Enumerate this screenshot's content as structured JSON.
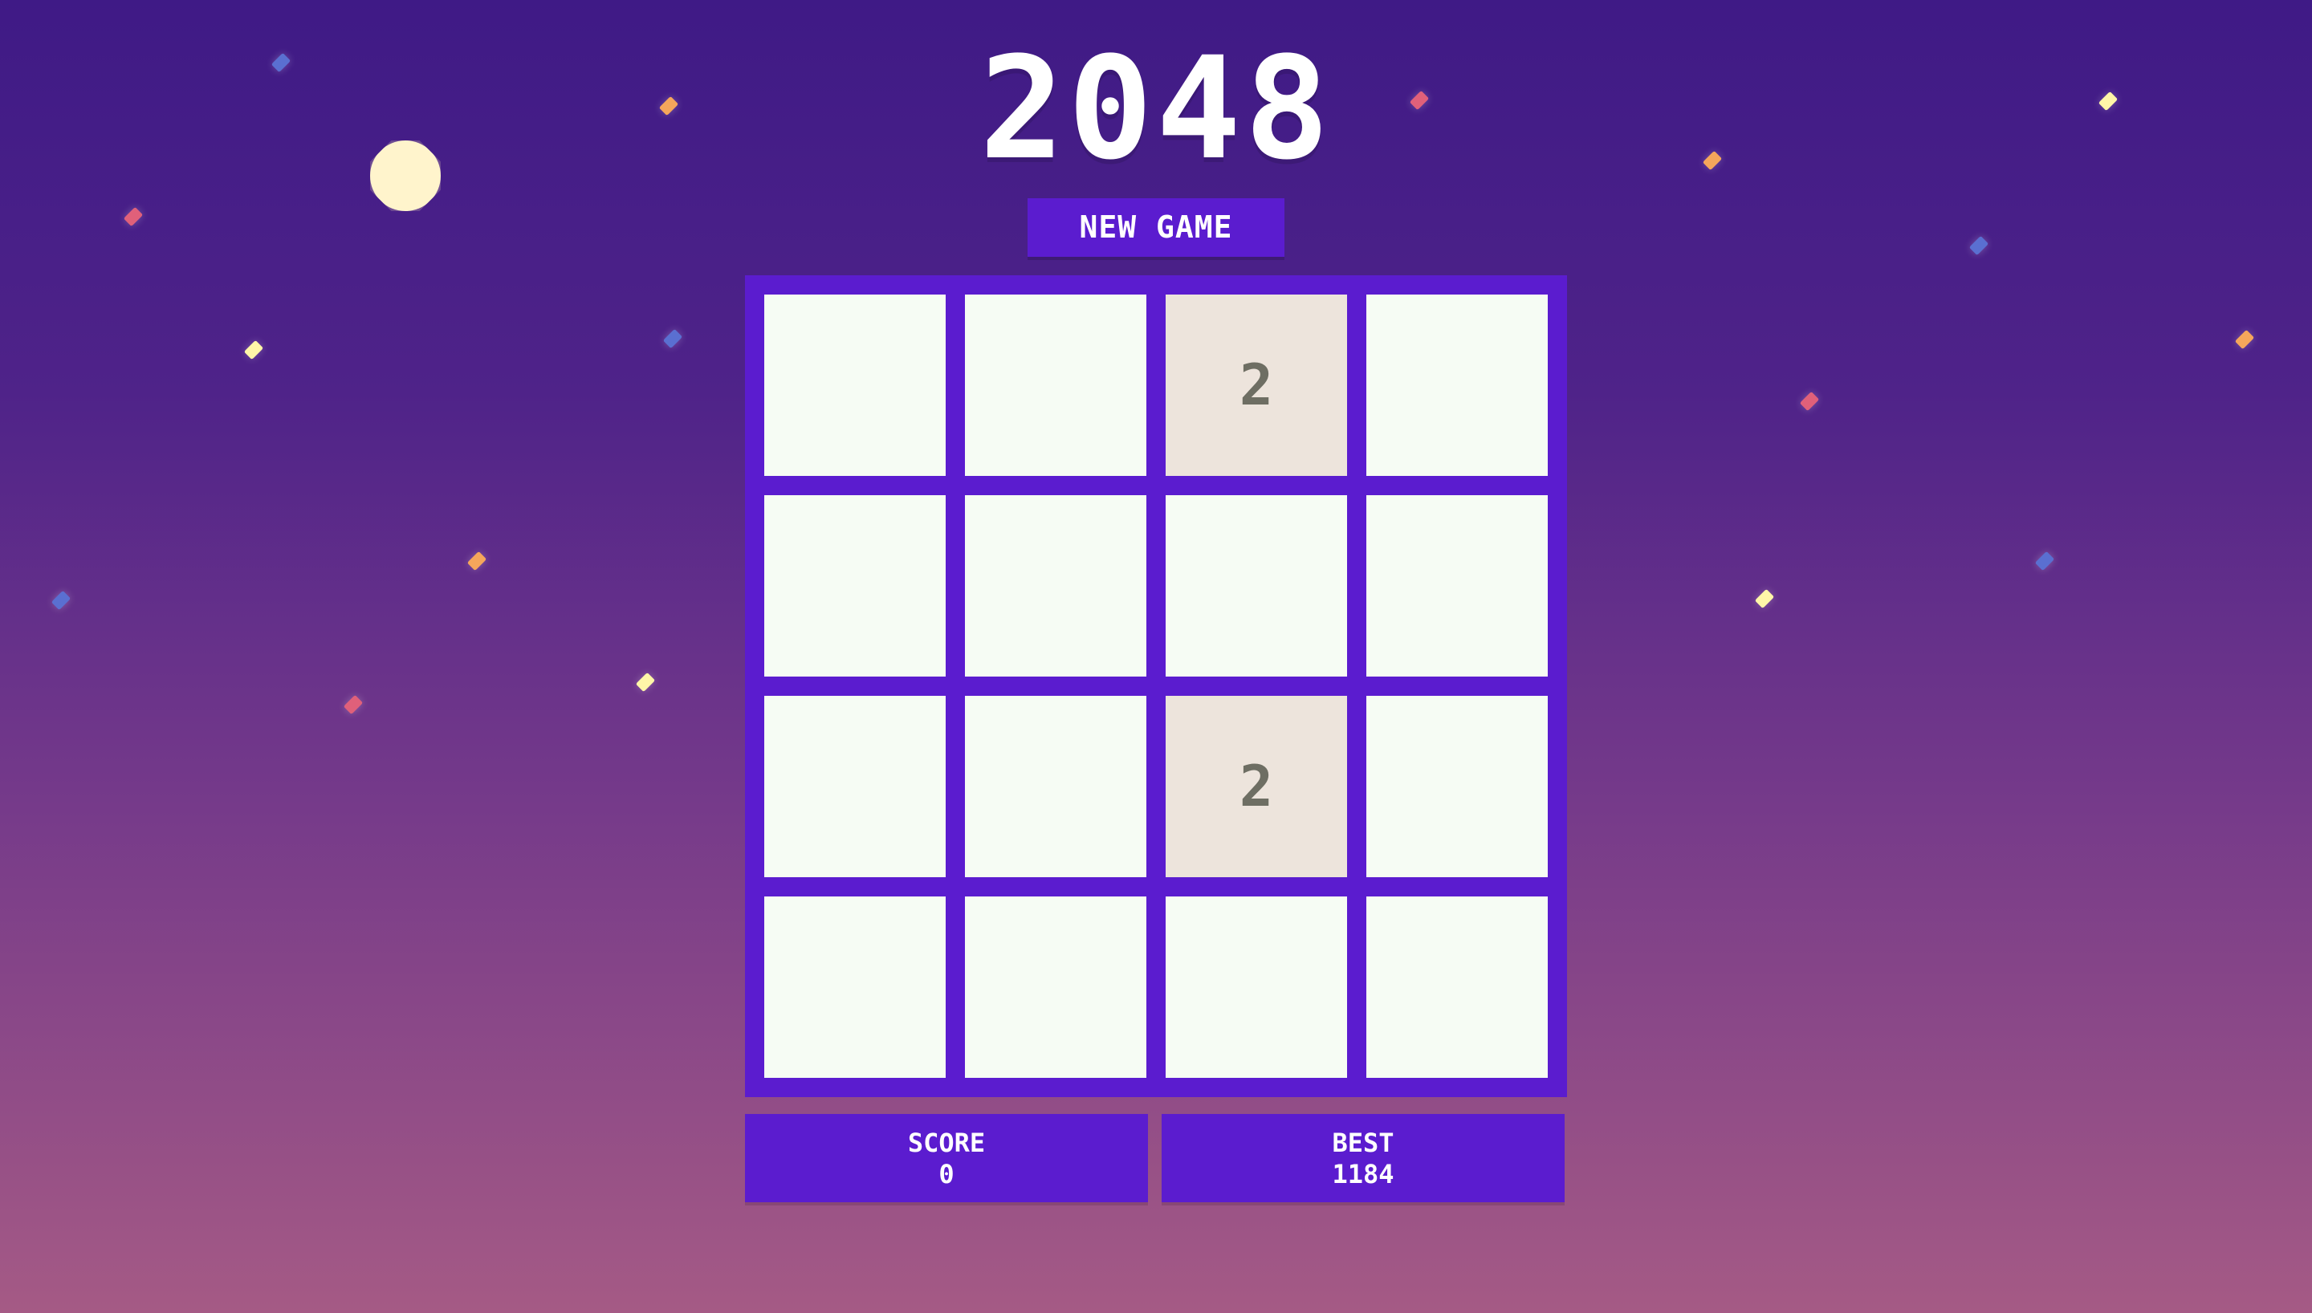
{
  "game": {
    "title": "2048",
    "new_game_label": "NEW GAME"
  },
  "board": {
    "rows": [
      [
        "",
        "",
        "2",
        ""
      ],
      [
        "",
        "",
        "",
        ""
      ],
      [
        "",
        "",
        "2",
        ""
      ],
      [
        "",
        "",
        "",
        ""
      ]
    ]
  },
  "stats": {
    "score_label": "SCORE",
    "score_value": "0",
    "best_label": "BEST",
    "best_value": "1184"
  },
  "colors": {
    "board": "#5b1ccf",
    "empty_cell": "#f6fcf4",
    "tile_2": "#ede4dc",
    "tile_text": "#6e6e63",
    "moon": "#fff4cc",
    "sparkle_colors": [
      "#fff6a8",
      "#f5a65b",
      "#e0607a",
      "#5a6fd1"
    ]
  },
  "icons": {
    "moon": "moon-icon",
    "sparkle": "sparkle-icon"
  }
}
